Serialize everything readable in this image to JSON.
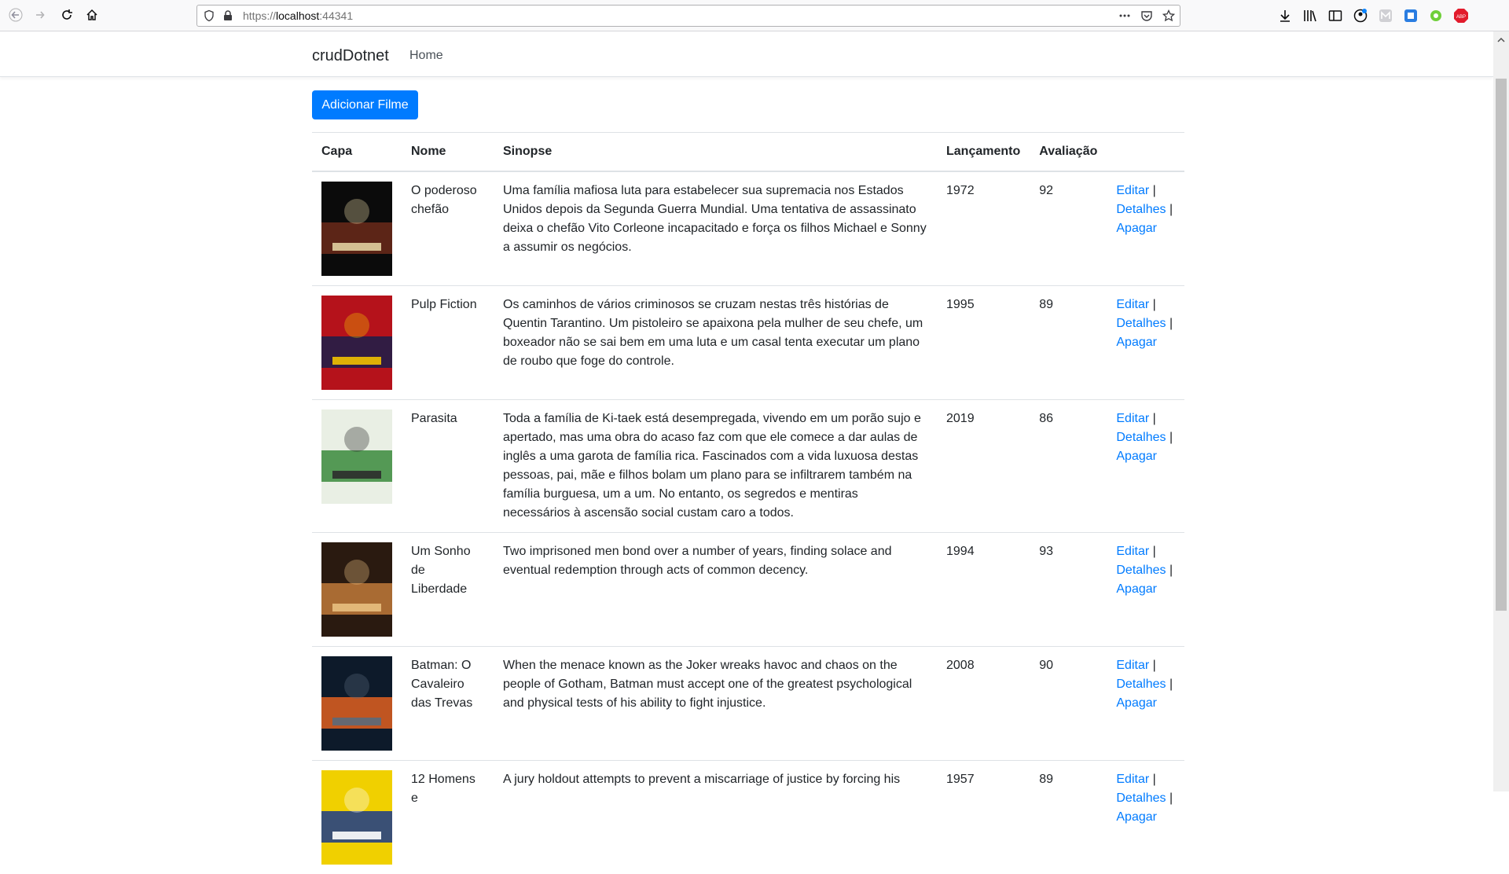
{
  "browser": {
    "url_prefix": "https://",
    "url_host": "localhost",
    "url_port": ":44341",
    "icons": [
      "back-icon",
      "forward-icon",
      "reload-icon",
      "home-icon",
      "shield-icon",
      "lock-icon",
      "more-icon",
      "pocket-icon",
      "bookmark-star-icon",
      "download-icon",
      "library-icon",
      "sidebar-icon",
      "account-icon",
      "extension-icons",
      "adblock-icon"
    ]
  },
  "navbar": {
    "brand": "crudDotnet",
    "home": "Home"
  },
  "actions": {
    "add_button": "Adicionar Filme"
  },
  "table": {
    "headers": {
      "capa": "Capa",
      "nome": "Nome",
      "sinopse": "Sinopse",
      "lancamento": "Lançamento",
      "avaliacao": "Avaliação"
    },
    "link_labels": {
      "edit": "Editar",
      "details": "Detalhes",
      "delete": "Apagar",
      "separator": "|"
    },
    "rows": [
      {
        "nome": "O poderoso chefão",
        "sinopse": "Uma família mafiosa luta para estabelecer sua supremacia nos Estados Unidos depois da Segunda Guerra Mundial. Uma tentativa de assassinato deixa o chefão Vito Corleone incapacitado e força os filhos Michael e Sonny a assumir os negócios.",
        "lancamento": "1972",
        "avaliacao": "92",
        "poster_colors": [
          "#0b0b0b",
          "#6b2a1a",
          "#e0d0a0"
        ]
      },
      {
        "nome": "Pulp Fiction",
        "sinopse": "Os caminhos de vários criminosos se cruzam nestas três histórias de Quentin Tarantino. Um pistoleiro se apaixona pela mulher de seu chefe, um boxeador não se sai bem em uma luta e um casal tenta executar um plano de roubo que foge do controle.",
        "lancamento": "1995",
        "avaliacao": "89",
        "poster_colors": [
          "#b5121b",
          "#1a1f4a",
          "#f2c200"
        ]
      },
      {
        "nome": "Parasita",
        "sinopse": "Toda a família de Ki-taek está desempregada, vivendo em um porão sujo e apertado, mas uma obra do acaso faz com que ele comece a dar aulas de inglês a uma garota de família rica. Fascinados com a vida luxuosa destas pessoas, pai, mãe e filhos bolam um plano para se infiltrarem também na família burguesa, um a um. No entanto, os segredos e mentiras necessários à ascensão social custam caro a todos.",
        "lancamento": "2019",
        "avaliacao": "86",
        "poster_colors": [
          "#e9efe4",
          "#3a8a3c",
          "#2c2c2c"
        ]
      },
      {
        "nome": "Um Sonho de Liberdade",
        "sinopse": "Two imprisoned men bond over a number of years, finding solace and eventual redemption through acts of common decency.",
        "lancamento": "1994",
        "avaliacao": "93",
        "poster_colors": [
          "#2a1a10",
          "#c07a3a",
          "#e8c080"
        ]
      },
      {
        "nome": "Batman: O Cavaleiro das Trevas",
        "sinopse": "When the menace known as the Joker wreaks havoc and chaos on the people of Gotham, Batman must accept one of the greatest psychological and physical tests of his ability to fight injustice.",
        "lancamento": "2008",
        "avaliacao": "90",
        "poster_colors": [
          "#0d1a2a",
          "#e06020",
          "#5a6a7a"
        ]
      },
      {
        "nome": "12 Homens e",
        "sinopse": "A jury holdout attempts to prevent a miscarriage of justice by forcing his",
        "lancamento": "1957",
        "avaliacao": "89",
        "poster_colors": [
          "#f0d000",
          "#1a3a8a",
          "#ffffff"
        ]
      }
    ]
  }
}
